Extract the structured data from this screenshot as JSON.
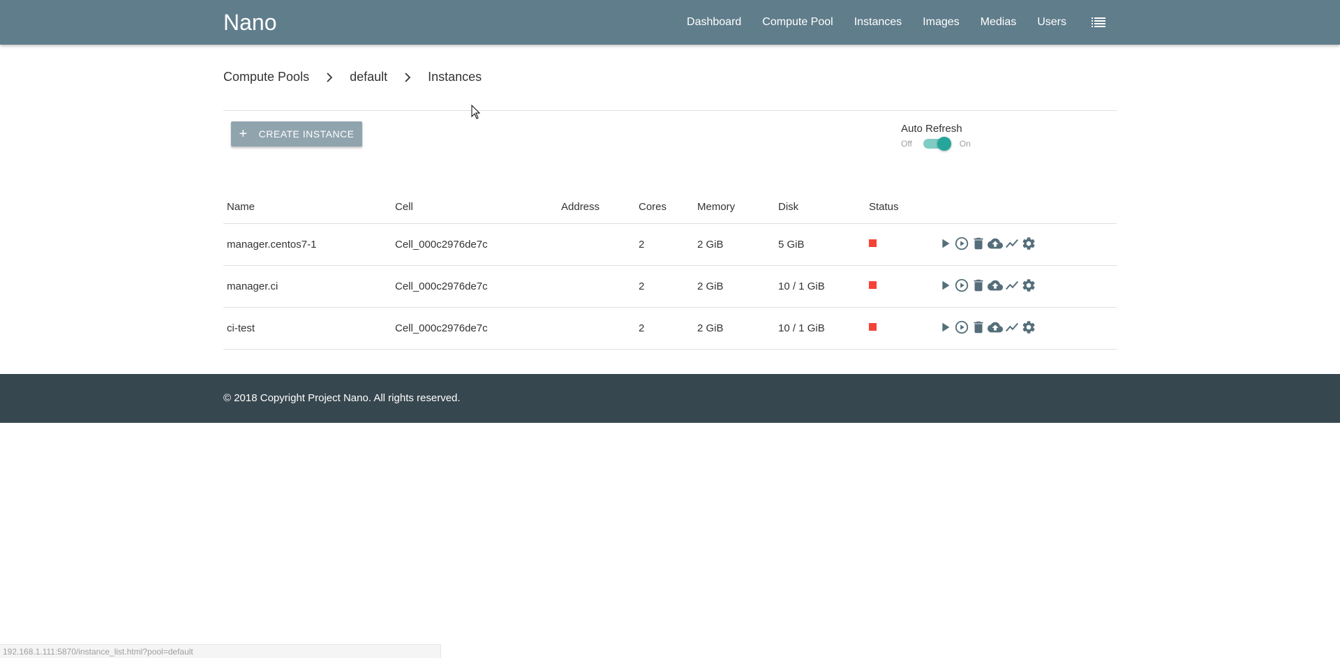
{
  "navbar": {
    "brand": "Nano",
    "links": [
      {
        "label": "Dashboard"
      },
      {
        "label": "Compute Pool"
      },
      {
        "label": "Instances"
      },
      {
        "label": "Images"
      },
      {
        "label": "Medias"
      },
      {
        "label": "Users"
      }
    ],
    "menu_icon": "list-icon"
  },
  "breadcrumb": {
    "items": [
      "Compute Pools",
      "default",
      "Instances"
    ],
    "separator_icon": "chevron-right-icon"
  },
  "toolbar": {
    "create_label": "CREATE INSTANCE",
    "create_icon": "plus-icon",
    "auto_refresh": {
      "label": "Auto Refresh",
      "off_label": "Off",
      "on_label": "On",
      "state": "on"
    }
  },
  "table": {
    "headers": {
      "name": "Name",
      "cell": "Cell",
      "address": "Address",
      "cores": "Cores",
      "memory": "Memory",
      "disk": "Disk",
      "status": "Status"
    },
    "rows": [
      {
        "name": "manager.centos7-1",
        "cell": "Cell_000c2976de7c",
        "address": "",
        "cores": "2",
        "memory": "2 GiB",
        "disk": "5 GiB",
        "status": "stopped"
      },
      {
        "name": "manager.ci",
        "cell": "Cell_000c2976de7c",
        "address": "",
        "cores": "2",
        "memory": "2 GiB",
        "disk": "10 / 1 GiB",
        "status": "stopped"
      },
      {
        "name": "ci-test",
        "cell": "Cell_000c2976de7c",
        "address": "",
        "cores": "2",
        "memory": "2 GiB",
        "disk": "10 / 1 GiB",
        "status": "stopped"
      }
    ],
    "action_icons": [
      "play-icon",
      "play-circle-icon",
      "delete-icon",
      "cloud-upload-icon",
      "trending-up-icon",
      "settings-icon"
    ]
  },
  "footer": {
    "copyright": "© 2018 Copyright Project Nano. All rights reserved."
  },
  "statusbar": {
    "url": "192.168.1.111:5870/instance_list.html?pool=default"
  },
  "colors": {
    "navbar": "#607d8b",
    "button": "#90a4ae",
    "switch_on": "#26a69a",
    "status_stopped": "#f44336",
    "footer": "#37474f",
    "icon": "#546e7a"
  }
}
